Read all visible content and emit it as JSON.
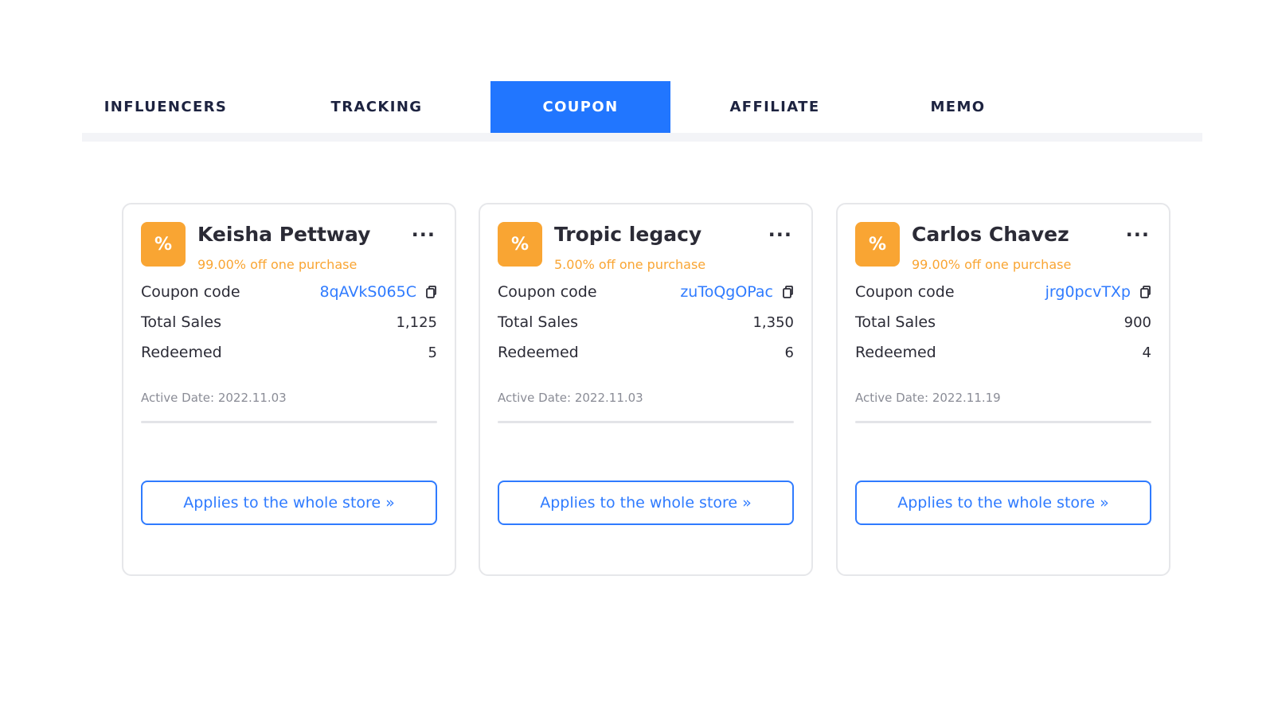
{
  "tabs": [
    {
      "label": "INFLUENCERS",
      "active": false
    },
    {
      "label": "TRACKING",
      "active": false
    },
    {
      "label": "COUPON",
      "active": true
    },
    {
      "label": "AFFILIATE",
      "active": false
    },
    {
      "label": "MEMO",
      "active": false
    }
  ],
  "labels": {
    "coupon_code": "Coupon code",
    "total_sales": "Total Sales",
    "redeemed": "Redeemed",
    "apply_button": "Applies to the whole store »",
    "more": "···"
  },
  "cards": [
    {
      "name": "Keisha Pettway",
      "discount": "99.00% off one purchase",
      "code": "8qAVkS065C",
      "total_sales": "1,125",
      "redeemed": "5",
      "active_date": "Active Date: 2022.11.03"
    },
    {
      "name": "Tropic legacy",
      "discount": "5.00% off one purchase",
      "code": "zuToQgOPac",
      "total_sales": "1,350",
      "redeemed": "6",
      "active_date": "Active Date: 2022.11.03"
    },
    {
      "name": "Carlos Chavez",
      "discount": "99.00% off one purchase",
      "code": "jrg0pcvTXp",
      "total_sales": "900",
      "redeemed": "4",
      "active_date": "Active Date: 2022.11.19"
    }
  ],
  "badge_symbol": "%",
  "colors": {
    "accent": "#2176ff",
    "link": "#2f7bff",
    "badge": "#f9a533"
  }
}
